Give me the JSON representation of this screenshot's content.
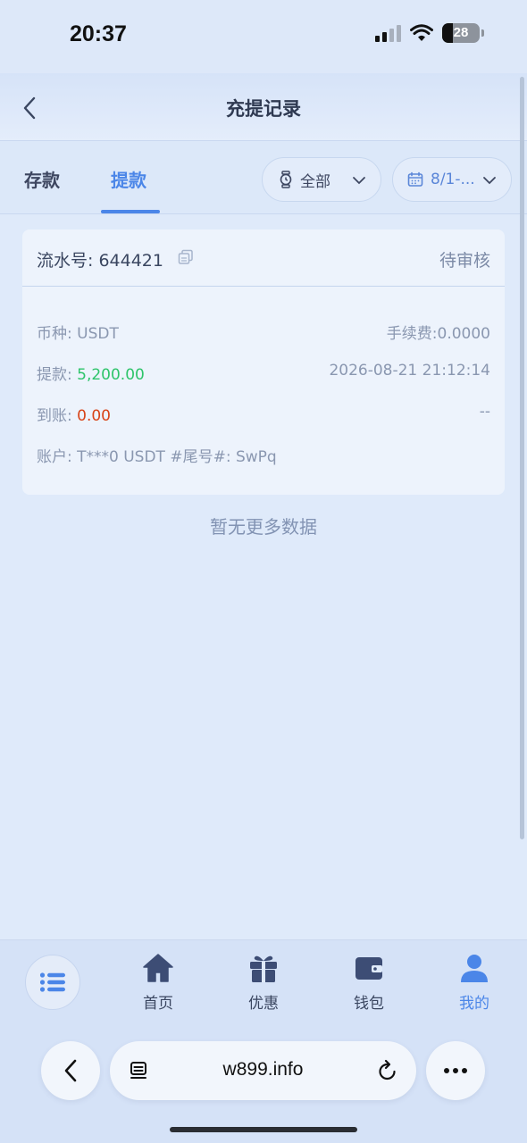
{
  "status_bar": {
    "time": "20:37",
    "battery": "28"
  },
  "header": {
    "title": "充提记录"
  },
  "tabs": [
    {
      "label": "存款",
      "active": false
    },
    {
      "label": "提款",
      "active": true
    }
  ],
  "filters": {
    "type": "全部",
    "date": "8/1-..."
  },
  "record": {
    "serial": "流水号: 644421",
    "status": "待审核",
    "currency": "币种: USDT",
    "fee": "手续费:0.0000",
    "withdraw_label": "提款: ",
    "withdraw_amount": "5,200.00",
    "datetime": "2026-08-21 21:12:14",
    "arrived_label": "到账: ",
    "arrived_amount": "0.00",
    "arrived_time": "--",
    "account": "账户: T***0 USDT #尾号#: SwPq"
  },
  "no_more": "暂无更多数据",
  "bottom_nav": {
    "items": [
      {
        "label": "首页",
        "icon": "home-icon"
      },
      {
        "label": "优惠",
        "icon": "gift-icon"
      },
      {
        "label": "钱包",
        "icon": "wallet-icon"
      },
      {
        "label": "我的",
        "icon": "user-icon",
        "active": true
      }
    ]
  },
  "browser": {
    "url": "w899.info"
  },
  "colors": {
    "accent": "#4b86e8",
    "green": "#2ec46a",
    "red": "#d84418",
    "background": "#dfeafa"
  }
}
